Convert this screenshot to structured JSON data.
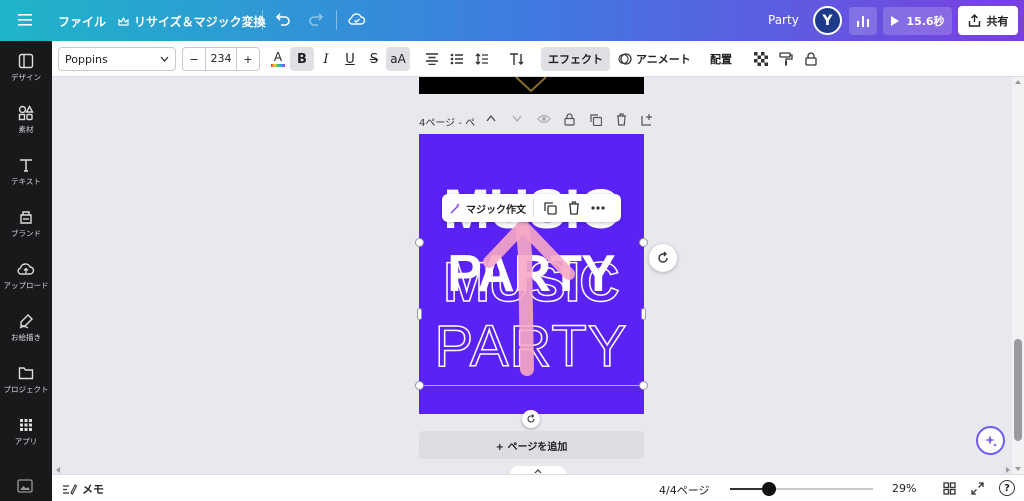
{
  "topbar": {
    "file_label": "ファイル",
    "resize_label": "リサイズ＆マジック変換",
    "design_title": "Party",
    "avatar_letter": "Y",
    "play_label": "15.6秒",
    "share_label": "共有"
  },
  "toolbar": {
    "font_name": "Poppins",
    "font_size": "234",
    "minus": "−",
    "plus": "+",
    "effects_label": "エフェクト",
    "animate_label": "アニメート",
    "position_label": "配置",
    "color_letter": "A",
    "bold": "B",
    "italic": "I",
    "underline": "U",
    "strike": "S",
    "case": "aA"
  },
  "sidebar": {
    "items": [
      {
        "label": "デザイン"
      },
      {
        "label": "素材"
      },
      {
        "label": "テキスト"
      },
      {
        "label": "ブランド"
      },
      {
        "label": "アップロード"
      },
      {
        "label": "お絵描き"
      },
      {
        "label": "プロジェクト"
      },
      {
        "label": "アプリ"
      }
    ]
  },
  "canvas": {
    "page_label": "4ページ - ペ",
    "magic_write_label": "マジック作文",
    "add_page_label": "+ ページを追加",
    "text_music": "MUSIC",
    "text_party": "PARTY",
    "page_bg": "#5b22f5"
  },
  "bottombar": {
    "notes_label": "メモ",
    "page_count": "4/4ページ",
    "zoom": "29%",
    "zoom_fraction": 0.2,
    "help": "?"
  }
}
